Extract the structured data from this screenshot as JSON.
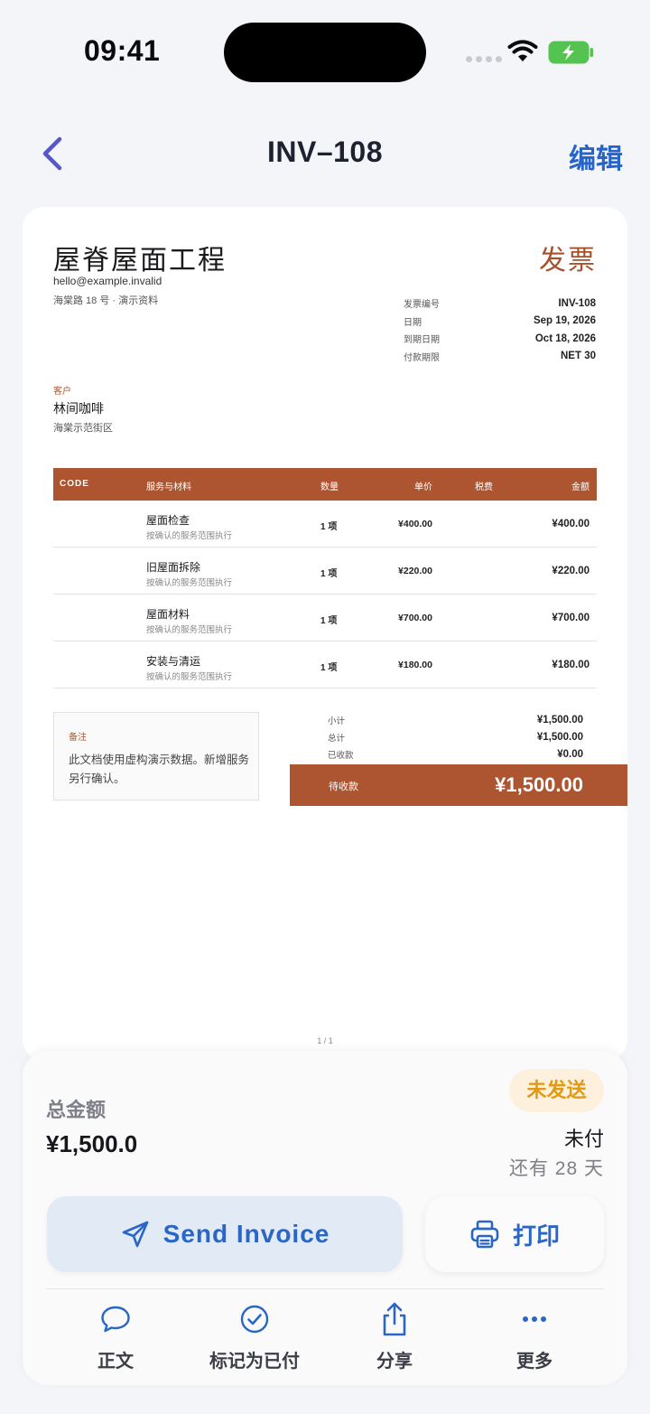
{
  "status_bar": {
    "time": "09:41"
  },
  "nav": {
    "title": "INV–108",
    "edit_label": "编辑"
  },
  "invoice": {
    "company_name": "屋脊屋面工程",
    "company_email": "hello@example.invalid",
    "company_address": "海棠路 18 号 · 演示资料",
    "doc_type": "发票",
    "meta": [
      {
        "label": "发票编号",
        "value": "INV-108"
      },
      {
        "label": "日期",
        "value": "Sep 19, 2026"
      },
      {
        "label": "到期日期",
        "value": "Oct 18, 2026"
      },
      {
        "label": "付款期限",
        "value": "NET 30"
      }
    ],
    "client_label": "客户",
    "client_name": "林间咖啡",
    "client_address": "海棠示范街区",
    "table_headers": {
      "code": "CODE",
      "service": "服务与材料",
      "qty": "数量",
      "price": "单价",
      "tax": "税费",
      "amount": "金额"
    },
    "items": [
      {
        "name": "屋面检查",
        "desc": "按确认的服务范围执行",
        "qty": "1 项",
        "price": "¥400.00",
        "amount": "¥400.00"
      },
      {
        "name": "旧屋面拆除",
        "desc": "按确认的服务范围执行",
        "qty": "1 项",
        "price": "¥220.00",
        "amount": "¥220.00"
      },
      {
        "name": "屋面材料",
        "desc": "按确认的服务范围执行",
        "qty": "1 项",
        "price": "¥700.00",
        "amount": "¥700.00"
      },
      {
        "name": "安装与清运",
        "desc": "按确认的服务范围执行",
        "qty": "1 项",
        "price": "¥180.00",
        "amount": "¥180.00"
      }
    ],
    "notes_label": "备注",
    "notes_text": "此文档使用虚构演示数据。新增服务另行确认。",
    "totals": [
      {
        "label": "小计",
        "value": "¥1,500.00"
      },
      {
        "label": "总计",
        "value": "¥1,500.00"
      },
      {
        "label": "已收款",
        "value": "¥0.00"
      }
    ],
    "balance_label": "待收款",
    "balance_value": "¥1,500.00",
    "page_number": "1 / 1"
  },
  "summary": {
    "total_label": "总金额",
    "total_value": "¥1,500.0",
    "status_badge": "未发送",
    "paid_status": "未付",
    "days_left": "还有 28 天"
  },
  "actions": {
    "send_label": "Send Invoice",
    "print_label": "打印"
  },
  "tabs": [
    {
      "label": "正文",
      "icon": "chat-bubble-icon"
    },
    {
      "label": "标记为已付",
      "icon": "check-circle-icon"
    },
    {
      "label": "分享",
      "icon": "share-icon"
    },
    {
      "label": "更多",
      "icon": "more-icon"
    }
  ],
  "colors": {
    "accent": "#2a66c5",
    "brand": "#ad5530",
    "badge": "#e19a16"
  }
}
